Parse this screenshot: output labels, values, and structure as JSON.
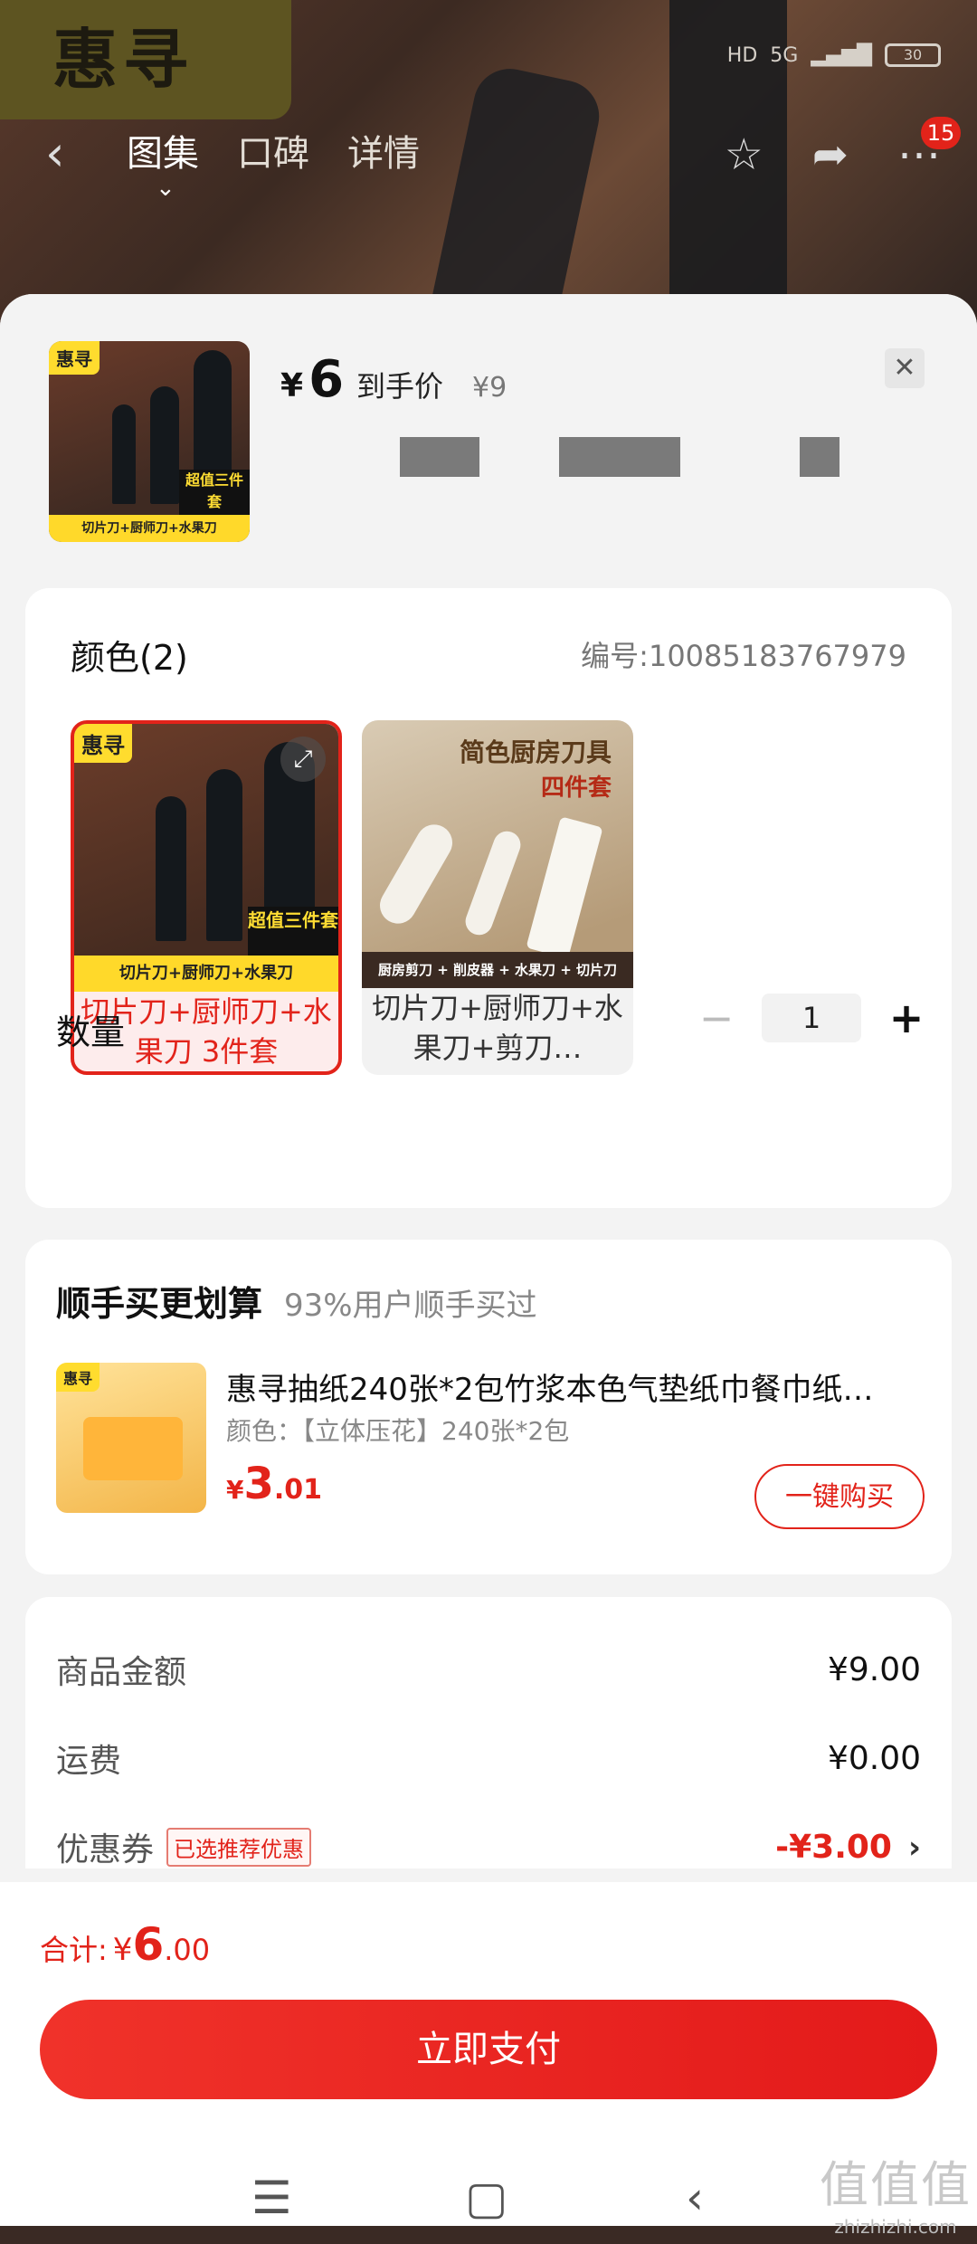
{
  "header": {
    "logo_text": "惠寻",
    "status": {
      "network": "5G",
      "hd": "HD",
      "battery": "30"
    },
    "tabs": [
      {
        "label": "图集"
      },
      {
        "label": "口碑"
      },
      {
        "label": "详情"
      }
    ],
    "indicator": "⌄",
    "more_badge": "15"
  },
  "product": {
    "price_symbol": "¥",
    "price": "6",
    "price_label": "到手价",
    "original_price": "¥9",
    "thumb_logo": "惠寻",
    "thumb_strip": "切片刀+厨师刀+水果刀",
    "thumb_tag": "超值三件套"
  },
  "options": {
    "title": "颜色(2)",
    "code": "编号:10085183767979",
    "items": [
      {
        "label": "切片刀+厨师刀+水果刀 3件套",
        "img_logo": "惠寻",
        "img_strip": "切片刀+厨师刀+水果刀",
        "img_tag": "超值三件套"
      },
      {
        "label": "切片刀+厨师刀+水果刀+剪刀…",
        "img_title": "简色厨房刀具",
        "img_sub": "四件套",
        "img_strip": "厨房剪刀 + 削皮器 + 水果刀 + 切片刀"
      }
    ],
    "quantity_label": "数量",
    "quantity": "1",
    "minus": "−",
    "plus": "+"
  },
  "addon": {
    "title": "顺手买更划算",
    "subtitle": "93%用户顺手买过",
    "name": "惠寻抽纸240张*2包竹浆本色气垫纸巾餐巾纸…",
    "spec": "颜色：【立体压花】240张*2包",
    "price_symbol": "¥",
    "price_int": "3",
    "price_dec": ".01",
    "buy_label": "一键购买",
    "img_logo": "惠寻"
  },
  "summary": {
    "rows": [
      {
        "label": "商品金额",
        "value": "¥9.00"
      },
      {
        "label": "运费",
        "value": "¥0.00"
      },
      {
        "label": "优惠券",
        "tag": "已选推荐优惠",
        "value": "-¥3.00"
      }
    ]
  },
  "footer": {
    "total_label": "合计:",
    "total_symbol": "¥",
    "total_int": "6",
    "total_dec": ".00",
    "pay_label": "立即支付"
  },
  "watermark": {
    "text": "值值值",
    "sub": "zhizhizhi.com"
  },
  "colors": {
    "accent": "#e2231a",
    "brand_yellow": "#ffdc2e"
  }
}
